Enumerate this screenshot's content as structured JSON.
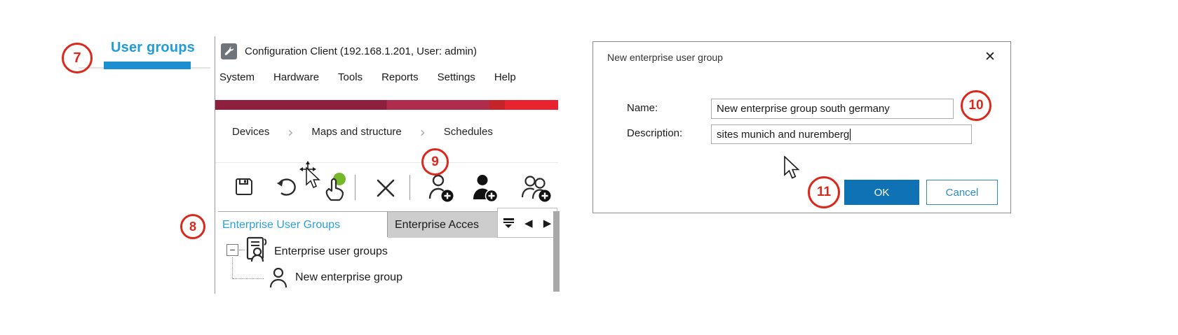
{
  "annotations": {
    "s7": "7",
    "s8": "8",
    "s9": "9",
    "s10": "10",
    "s11": "11"
  },
  "left_nav": {
    "label": "User groups"
  },
  "window": {
    "title": "Configuration Client (192.168.1.201, User: admin)",
    "menu": [
      "System",
      "Hardware",
      "Tools",
      "Reports",
      "Settings",
      "Help"
    ],
    "breadcrumbs": [
      "Devices",
      "Maps and structure",
      "Schedules"
    ],
    "breadcrumb_sep": "›",
    "tabs": {
      "active": "Enterprise User Groups",
      "inactive": "Enterprise Acces"
    },
    "tab_icons": {
      "scroll_left": "◀",
      "scroll_right": "▶"
    },
    "tree": {
      "expander": "−",
      "root": "Enterprise user groups",
      "child": "New enterprise group"
    }
  },
  "dialog": {
    "title": "New enterprise user group",
    "close_icon": "✕",
    "name_label": "Name:",
    "name_value": "New enterprise group south germany",
    "description_label": "Description:",
    "description_value": "sites munich and nuremberg",
    "ok_label": "OK",
    "cancel_label": "Cancel"
  },
  "colors": {
    "accent_blue": "#1F9CD9",
    "ok_blue": "#0E72B5",
    "annotation_red": "#DA291C",
    "brand_bar": [
      "#8E1F3E",
      "#AF2C4D",
      "#C32329",
      "#E8232D"
    ]
  }
}
